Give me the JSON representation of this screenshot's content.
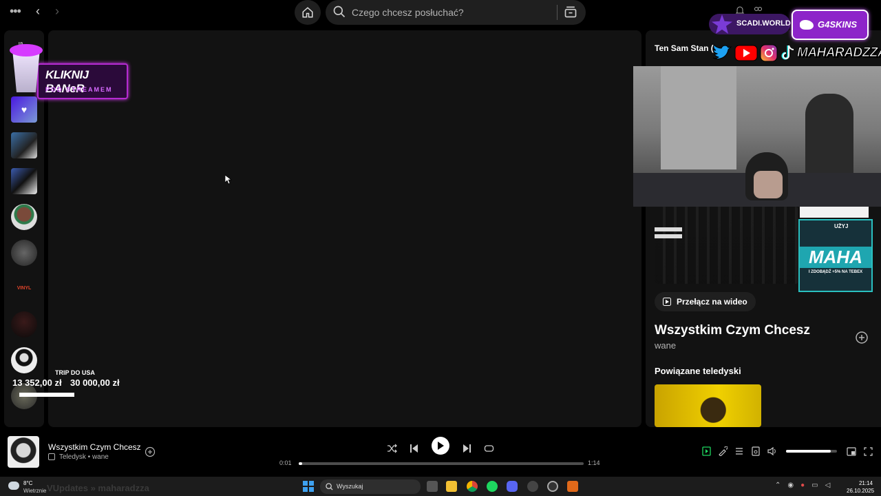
{
  "topbar": {
    "search_placeholder": "Czego chcesz posłuchać?"
  },
  "now_playing_panel": {
    "header": "Ten Sam Stan (",
    "switch_video_label": "Przełącz na wideo",
    "title": "Wszystkim Czym Chcesz",
    "artist": "wane",
    "related_heading": "Powiązane teledyski"
  },
  "stream_overlay": {
    "banner_line1": "KLIKNIJ BANeR",
    "banner_line2": "POD STREAMEM",
    "donation_label": "TRIP DO USA",
    "donation_current": "13 352,00 zł",
    "donation_goal": "30 000,00 zł",
    "donation_fraction": 0.445,
    "sponsor1": "SCADI.WORLD",
    "sponsor2": "G4SKINS",
    "handle": "MAHARADZZA",
    "promo_top": "UŻYJ",
    "promo_main": "MAHA",
    "promo_sub": "I ZDOBĄDŹ +5% NA TEBEX",
    "ticker": "VUpdates » maharadzza"
  },
  "sidebar": {
    "items": [
      "liked-songs",
      "playlist-1",
      "playlist-2",
      "artist-1",
      "artist-2",
      "vinyl-logo",
      "artist-3",
      "artist-4",
      "artist-5"
    ]
  },
  "player": {
    "track_title": "Wszystkim Czym Chcesz",
    "track_sub": "Teledysk • wane",
    "time_current": "0:01",
    "time_total": "1:14",
    "progress_fraction": 0.012,
    "volume_fraction": 0.88
  },
  "taskbar": {
    "weather_temp": "8°C",
    "weather_desc": "Wietrznie",
    "search_label": "Wyszukaj",
    "time": "21:14",
    "date": "26.10.2025"
  },
  "colors": {
    "accent_green": "#1ed760",
    "panel_bg": "#121212",
    "overlay_purple": "#b52bd1"
  }
}
